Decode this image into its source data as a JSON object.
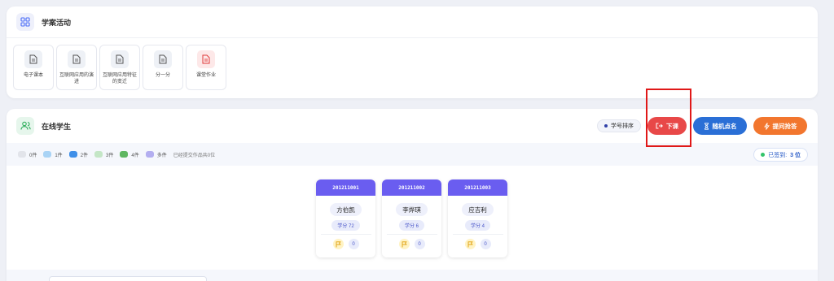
{
  "activity": {
    "title": "学案活动",
    "tiles": [
      {
        "label": "电子课本",
        "icon": "document-icon"
      },
      {
        "label": "互联网应用的演进",
        "icon": "document-icon"
      },
      {
        "label": "互联网应用特征的变迁",
        "icon": "document-icon"
      },
      {
        "label": "分一分",
        "icon": "document-icon"
      },
      {
        "label": "课堂作业",
        "icon": "document-red-icon"
      }
    ]
  },
  "students": {
    "title": "在线学生",
    "sort_label": "学号排序",
    "end_class_label": "下课",
    "random_call_label": "随机点名",
    "quick_answer_label": "提问抢答",
    "legend": [
      {
        "label": "0件",
        "color": "#e2e4ea"
      },
      {
        "label": "1件",
        "color": "#a9d3f5"
      },
      {
        "label": "2件",
        "color": "#3f8fe8"
      },
      {
        "label": "3件",
        "color": "#c4e6c6"
      },
      {
        "label": "4件",
        "color": "#5eb661"
      },
      {
        "label": "多件",
        "color": "#b3aef0"
      }
    ],
    "legend_note": "已经提交作品共0位",
    "signed_label": "已签到:",
    "signed_count": "3 位",
    "cards": [
      {
        "id": "201211001",
        "name": "方伯凯",
        "score": "学分 72",
        "count": "0"
      },
      {
        "id": "201211002",
        "name": "李烨琪",
        "score": "学分 6",
        "count": "0"
      },
      {
        "id": "201211003",
        "name": "应吉利",
        "score": "学分 4",
        "count": "0"
      }
    ]
  },
  "colors": {
    "accent_purple": "#6a5df0",
    "end_class_red": "#e84848",
    "random_call_blue": "#2a6fd6",
    "quick_answer_orange": "#f2762e",
    "signed_green": "#34c46a"
  }
}
